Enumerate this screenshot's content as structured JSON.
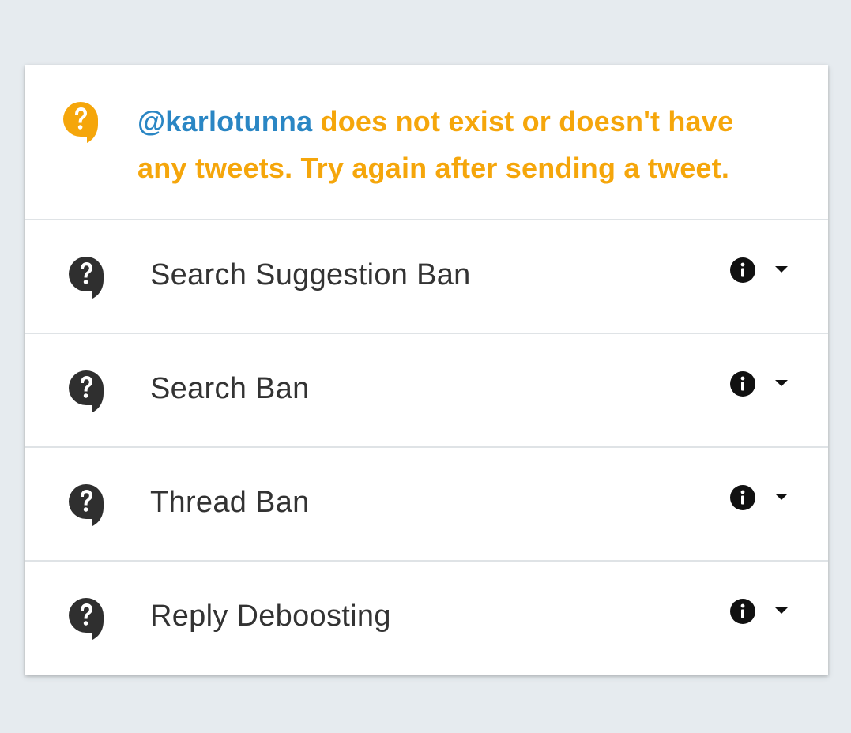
{
  "alert": {
    "handle": "@karlotunna",
    "message": " does not exist or doesn't have any tweets. Try again after sending a tweet.",
    "icon": "question-bubble-icon",
    "color": "#f5a60b",
    "handle_color": "#2a86c4"
  },
  "checks": [
    {
      "label": "Search Suggestion Ban",
      "icon": "question-bubble-icon"
    },
    {
      "label": "Search Ban",
      "icon": "question-bubble-icon"
    },
    {
      "label": "Thread Ban",
      "icon": "question-bubble-icon"
    },
    {
      "label": "Reply Deboosting",
      "icon": "question-bubble-icon"
    }
  ],
  "colors": {
    "background": "#e6ebef",
    "card": "#ffffff",
    "text": "#333333",
    "icon_dark": "#2f2f2f",
    "divider": "#dfe3e6"
  }
}
